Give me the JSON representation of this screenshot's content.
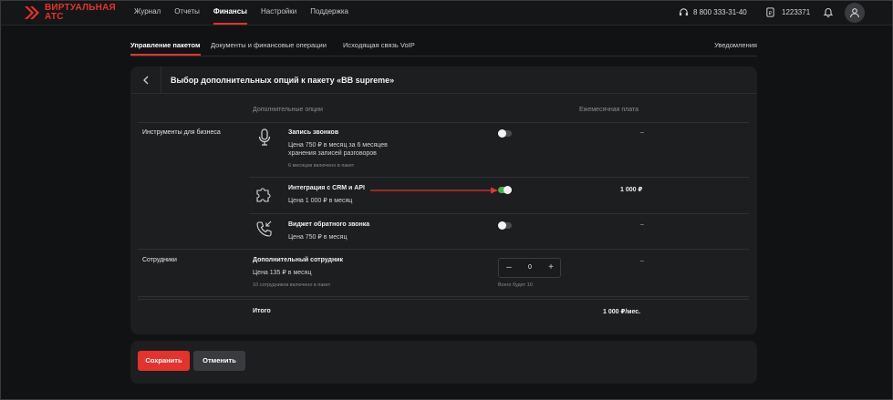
{
  "brand": {
    "line1": "ВИРТУАЛЬНАЯ",
    "line2": "АТС",
    "accent_color": "#e5322d"
  },
  "nav": {
    "items": [
      {
        "label": "Журнал",
        "active": false
      },
      {
        "label": "Отчеты",
        "active": false
      },
      {
        "label": "Финансы",
        "active": true
      },
      {
        "label": "Настройки",
        "active": false
      },
      {
        "label": "Поддержка",
        "active": false
      }
    ]
  },
  "header": {
    "phone": "8 800 333-31-40",
    "account": "1223371",
    "icons": [
      "headset-icon",
      "account-icon",
      "bell-icon",
      "user-icon"
    ]
  },
  "subtabs": {
    "items": [
      {
        "label": "Управление пакетом",
        "active": true
      },
      {
        "label": "Документы и финансовые операции",
        "active": false
      },
      {
        "label": "Исходящая связь VoIP",
        "active": false
      }
    ],
    "right": "Уведомления"
  },
  "card": {
    "title": "Выбор дополнительных опций к пакету «BB supreme»",
    "col_options": "Дополнительные опции",
    "col_monthly": "Ежемесячная плата",
    "section_business": "Инструменты для бизнеса",
    "section_staff": "Сотрудники",
    "options": [
      {
        "title": "Запись звонков",
        "price_line1": "Цена 750 ₽ в месяц за 6 месяцев",
        "price_line2": "хранения записей разговоров",
        "note": "6 месяцев включено в пакет",
        "enabled": false,
        "monthly": "–",
        "icon": "microphone-icon"
      },
      {
        "title": "Интеграция с CRM и API",
        "price_line1": "Цена 1 000 ₽ в месяц",
        "enabled": true,
        "monthly": "1 000 ₽",
        "icon": "puzzle-icon"
      },
      {
        "title": "Виджет обратного звонка",
        "price_line1": "Цена 750 ₽ в месяц",
        "enabled": false,
        "monthly": "–",
        "icon": "callback-phone-icon"
      }
    ],
    "staff": {
      "title": "Дополнительный сотрудник",
      "price": "Цена 135 ₽ в месяц",
      "note": "10 сотрудников включено в пакет",
      "value": "0",
      "minus": "–",
      "plus": "+",
      "total_note": "Всего будет 10",
      "monthly": "–"
    },
    "total_label": "Итого",
    "total_value": "1 000 ₽/мес."
  },
  "footer": {
    "save_label": "Сохранить",
    "cancel_label": "Отменить"
  },
  "colors": {
    "toggle_on": "#4caf50",
    "annotation_arrow": "#e5322d"
  }
}
